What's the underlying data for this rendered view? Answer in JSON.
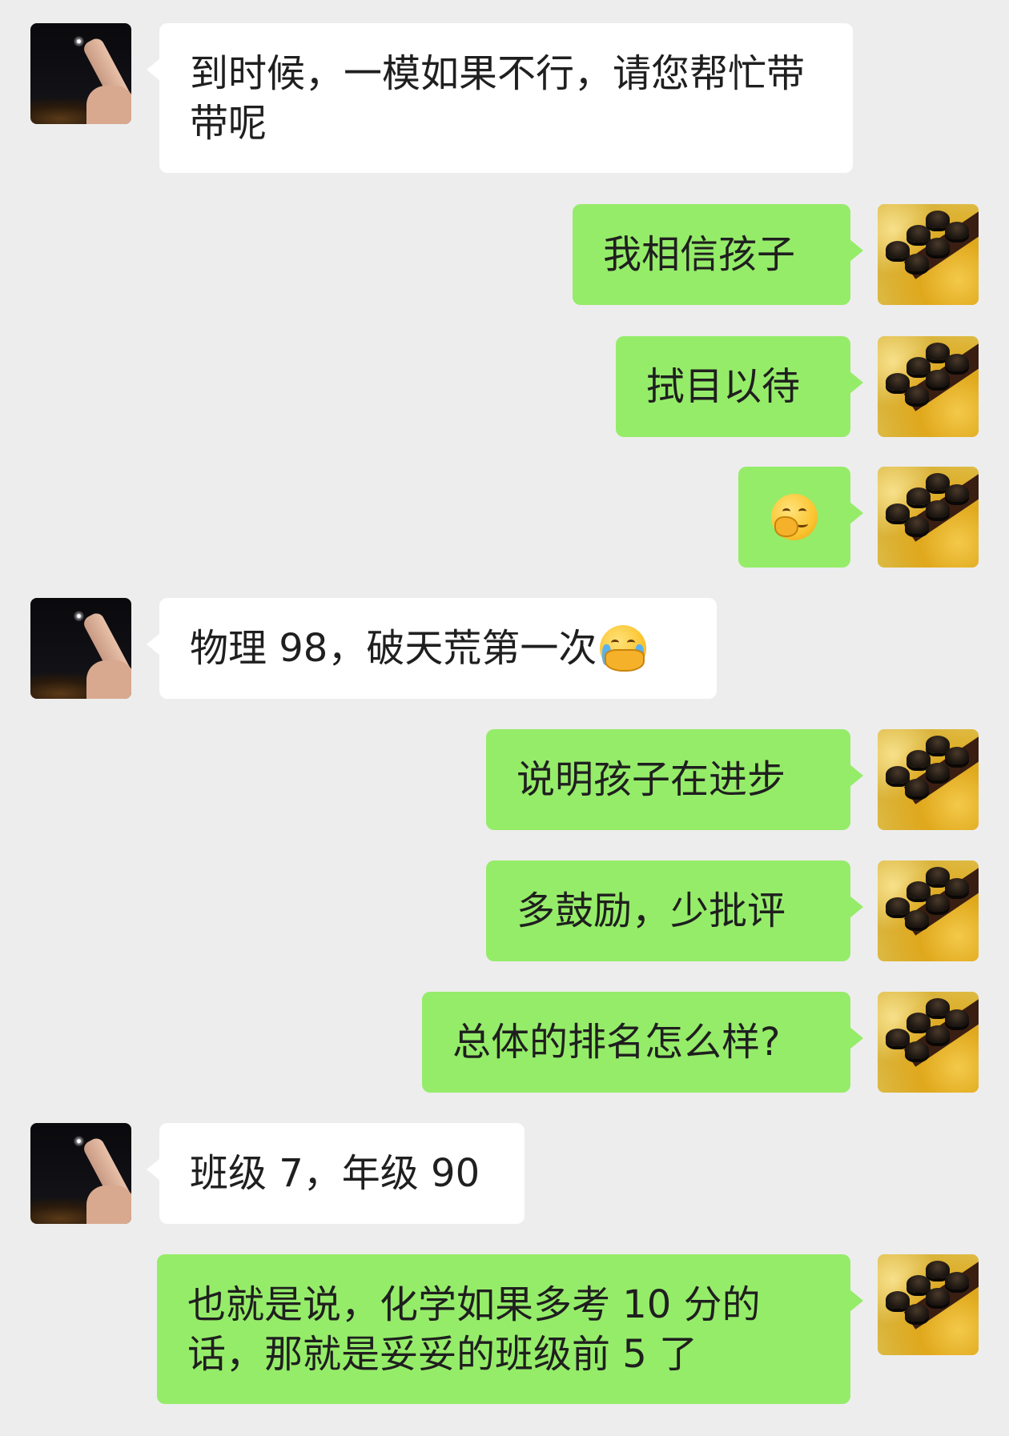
{
  "messages": [
    {
      "side": "in",
      "text": "到时候，一模如果不行，请您帮忙带带呢"
    },
    {
      "side": "out",
      "text": "我相信孩子"
    },
    {
      "side": "out",
      "text": "拭目以待"
    },
    {
      "side": "out",
      "text": "",
      "emoji": "hand-over-mouth-emoji"
    },
    {
      "side": "in",
      "text": "物理 98，破天荒第一次",
      "emoji": "crying-face-emoji"
    },
    {
      "side": "out",
      "text": "说明孩子在进步"
    },
    {
      "side": "out",
      "text": "多鼓励，少批评"
    },
    {
      "side": "out",
      "text": "总体的排名怎么样?"
    },
    {
      "side": "in",
      "text": "班级 7，年级 90"
    },
    {
      "side": "out",
      "text": "也就是说，化学如果多考 10 分的话，那就是妥妥的班级前 5 了"
    }
  ],
  "colors": {
    "background": "#ededed",
    "incoming_bubble": "#ffffff",
    "outgoing_bubble": "#95ec69"
  },
  "avatars": {
    "incoming": "finger-at-night-avatar",
    "outgoing": "roof-tiles-avatar"
  }
}
